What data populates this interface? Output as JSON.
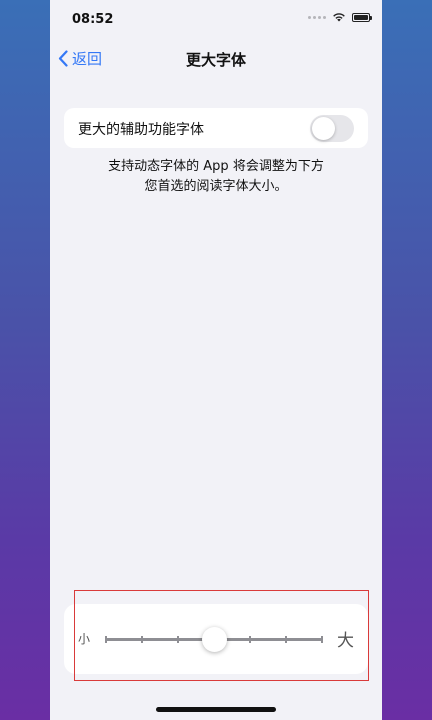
{
  "status_bar": {
    "time": "08:52"
  },
  "nav": {
    "back_label": "返回",
    "title": "更大字体"
  },
  "larger_accessibility": {
    "label": "更大的辅助功能字体",
    "enabled": false
  },
  "description": {
    "line1": "支持动态字体的 App 将会调整为下方",
    "line2": "您首选的阅读字体大小。"
  },
  "font_slider": {
    "min_label": "小",
    "max_label": "大",
    "steps": 7,
    "selected_step": 3
  }
}
